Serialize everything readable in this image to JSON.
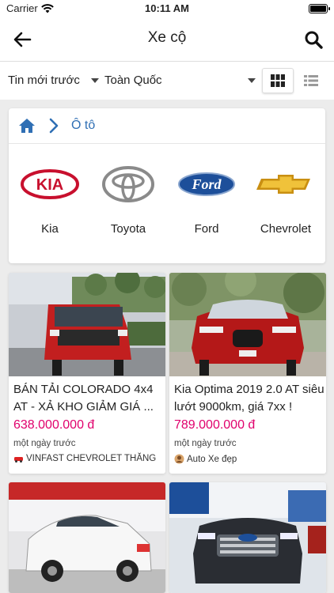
{
  "status_bar": {
    "carrier": "Carrier",
    "time": "10:11 AM"
  },
  "nav": {
    "title": "Xe cộ"
  },
  "filters": {
    "sort_label": "Tin mới trước",
    "location_label": "Toàn Quốc"
  },
  "breadcrumb": {
    "current": "Ô tô"
  },
  "brands": [
    {
      "name": "Kia",
      "logo_text": "KIA"
    },
    {
      "name": "Toyota"
    },
    {
      "name": "Ford",
      "logo_text": "Ford"
    },
    {
      "name": "Chevrolet"
    }
  ],
  "listings": [
    {
      "title": "BÁN TẢI COLORADO 4x4 AT - XẢ KHO GIẢM GIÁ ...",
      "price": "638.000.000 đ",
      "time": "một ngày trước",
      "seller": "VINFAST CHEVROLET THĂNG"
    },
    {
      "title": "Kia Optima 2019 2.0 AT siêu lướt 9000km, giá 7xx !",
      "price": "789.000.000 đ",
      "time": "một ngày trước",
      "seller": "Auto Xe đẹp"
    },
    {
      "title": "",
      "price": "",
      "time": "",
      "seller": ""
    },
    {
      "title": "",
      "price": "",
      "time": "",
      "seller": ""
    }
  ],
  "colors": {
    "accent_blue": "#2f6fb4",
    "price_pink": "#e0006c",
    "kia_red": "#c8102e",
    "ford_blue": "#1d4f9a",
    "chevy_gold": "#e8b82a"
  }
}
